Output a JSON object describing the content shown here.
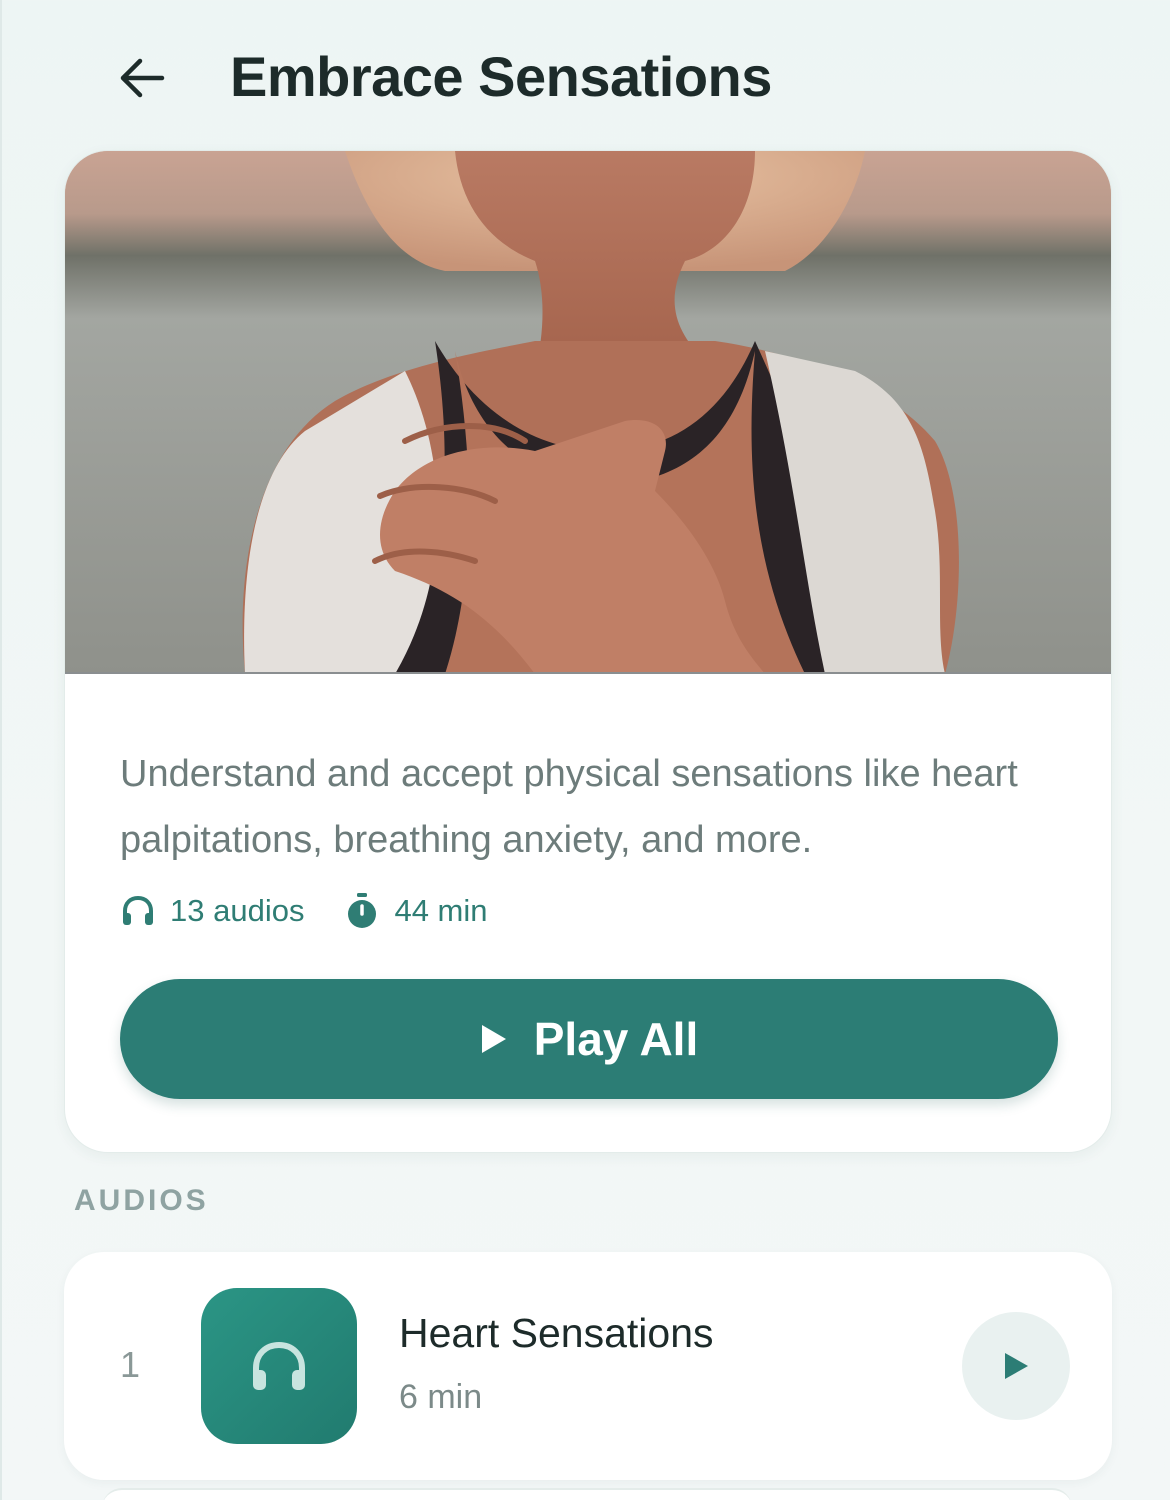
{
  "header": {
    "title": "Embrace Sensations",
    "back_icon": "arrow-left-icon"
  },
  "hero": {
    "image_subject": "woman-hand-on-chest-photo",
    "description": "Understand and accept physical sensations like heart palpitations, breathing anxiety, and more.",
    "audios_count": "13 audios",
    "total_duration": "44 min",
    "audios_icon": "headphones-icon",
    "duration_icon": "stopwatch-icon",
    "play_all_label": "Play All"
  },
  "section": {
    "label": "AUDIOS"
  },
  "audios": [
    {
      "index": "1",
      "title": "Heart Sensations",
      "duration": "6 min",
      "icon": "headphones-icon"
    }
  ],
  "colors": {
    "accent": "#2c7d75",
    "title_text": "#1d2b2a",
    "muted_text": "#6d7c7b",
    "background": "#edf5f4"
  }
}
